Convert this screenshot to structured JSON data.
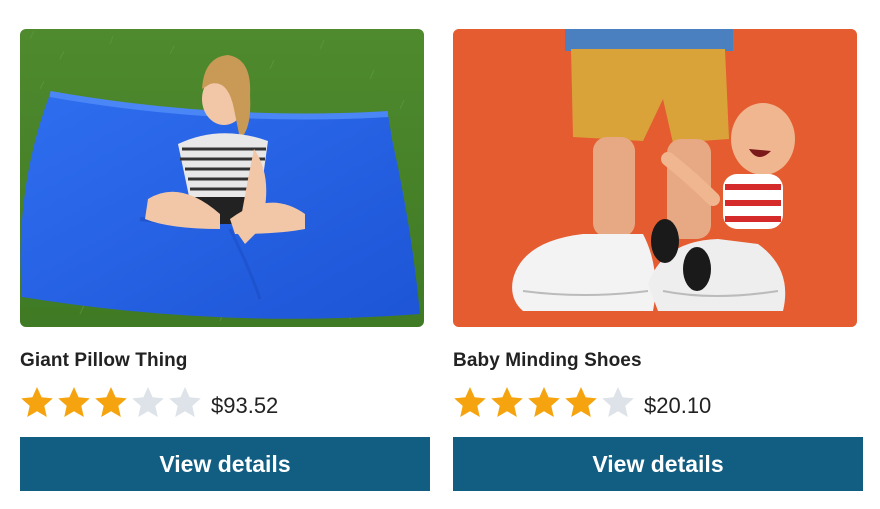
{
  "colors": {
    "star_filled": "#f5a40f",
    "star_empty": "#dde3e8",
    "button_bg": "#115e82",
    "button_text": "#ffffff"
  },
  "products": [
    {
      "title": "Giant Pillow Thing",
      "price": "$93.52",
      "rating": 3,
      "rating_max": 5,
      "button_label": "View details",
      "image_icon": "giant-pillow-photo"
    },
    {
      "title": "Baby Minding Shoes",
      "price": "$20.10",
      "rating": 4,
      "rating_max": 5,
      "button_label": "View details",
      "image_icon": "baby-minding-shoes-photo"
    }
  ]
}
